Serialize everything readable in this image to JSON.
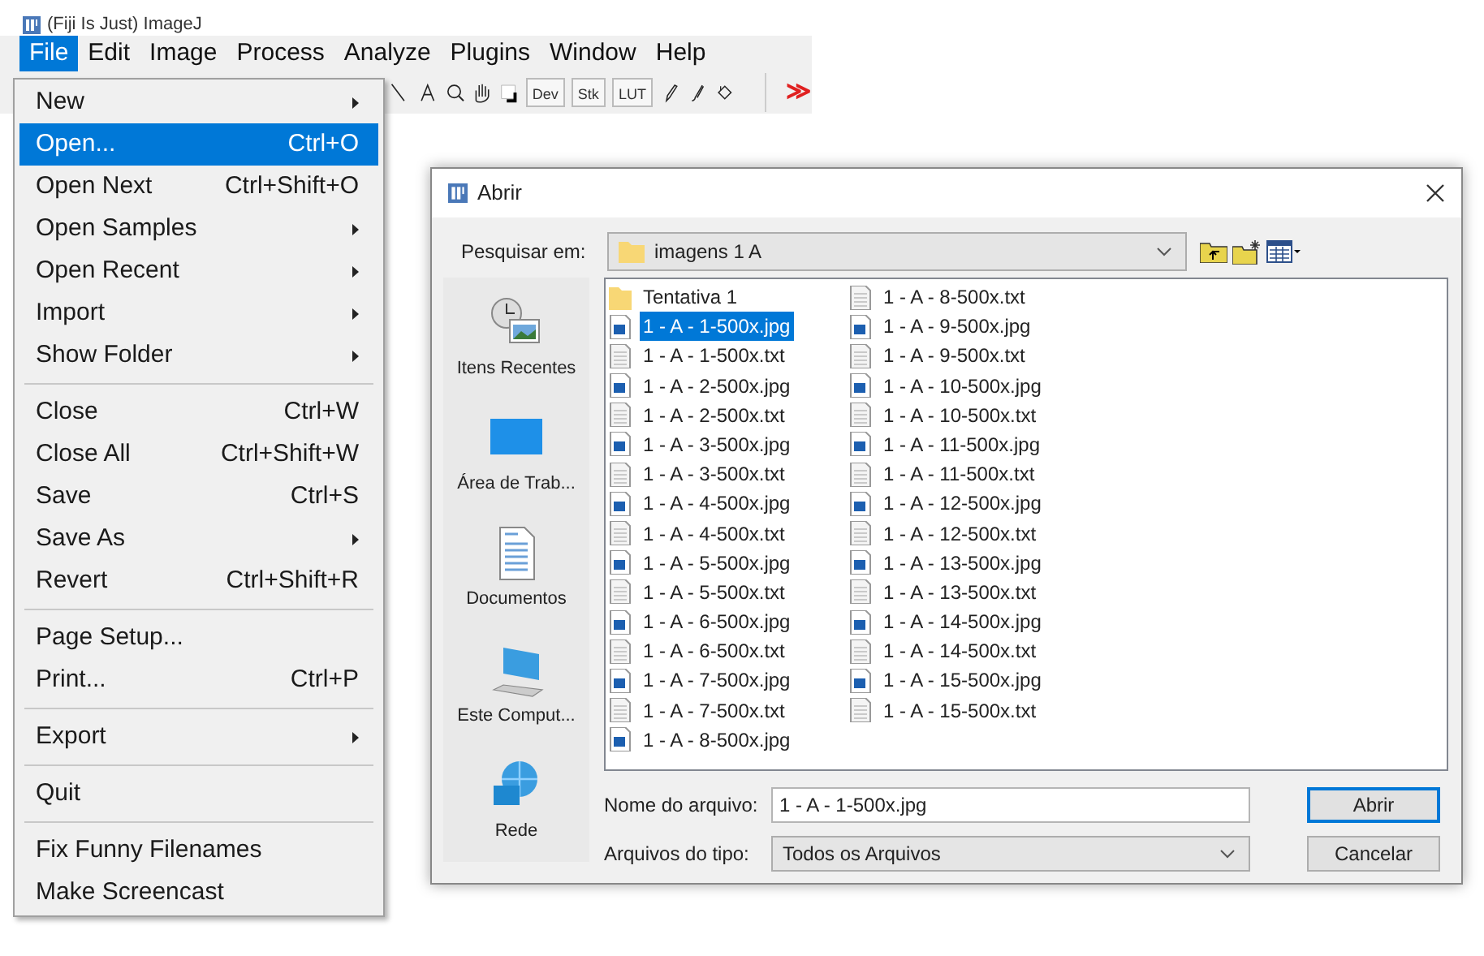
{
  "window": {
    "title": "(Fiji Is Just) ImageJ"
  },
  "menu_bar": [
    {
      "label": "File",
      "selected": true
    },
    {
      "label": "Edit",
      "selected": false
    },
    {
      "label": "Image",
      "selected": false
    },
    {
      "label": "Process",
      "selected": false
    },
    {
      "label": "Analyze",
      "selected": false
    },
    {
      "label": "Plugins",
      "selected": false
    },
    {
      "label": "Window",
      "selected": false
    },
    {
      "label": "Help",
      "selected": false
    }
  ],
  "toolbar": {
    "menus": [
      "Dev",
      "Stk",
      "LUT"
    ],
    "more": "≫"
  },
  "file_menu": [
    {
      "kind": "item",
      "label": "New",
      "submenu": true,
      "selected": false
    },
    {
      "kind": "item",
      "label": "Open...",
      "shortcut": "Ctrl+O",
      "selected": true
    },
    {
      "kind": "item",
      "label": "Open Next",
      "shortcut": "Ctrl+Shift+O",
      "selected": false
    },
    {
      "kind": "item",
      "label": "Open Samples",
      "submenu": true,
      "selected": false
    },
    {
      "kind": "item",
      "label": "Open Recent",
      "submenu": true,
      "selected": false
    },
    {
      "kind": "item",
      "label": "Import",
      "submenu": true,
      "selected": false
    },
    {
      "kind": "item",
      "label": "Show Folder",
      "submenu": true,
      "selected": false
    },
    {
      "kind": "separator"
    },
    {
      "kind": "item",
      "label": "Close",
      "shortcut": "Ctrl+W",
      "selected": false
    },
    {
      "kind": "item",
      "label": "Close All",
      "shortcut": "Ctrl+Shift+W",
      "selected": false
    },
    {
      "kind": "item",
      "label": "Save",
      "shortcut": "Ctrl+S",
      "selected": false
    },
    {
      "kind": "item",
      "label": "Save As",
      "submenu": true,
      "selected": false
    },
    {
      "kind": "item",
      "label": "Revert",
      "shortcut": "Ctrl+Shift+R",
      "selected": false
    },
    {
      "kind": "separator"
    },
    {
      "kind": "item",
      "label": "Page Setup...",
      "selected": false
    },
    {
      "kind": "item",
      "label": "Print...",
      "shortcut": "Ctrl+P",
      "selected": false
    },
    {
      "kind": "separator"
    },
    {
      "kind": "item",
      "label": "Export",
      "submenu": true,
      "selected": false
    },
    {
      "kind": "separator"
    },
    {
      "kind": "item",
      "label": "Quit",
      "selected": false
    },
    {
      "kind": "separator"
    },
    {
      "kind": "item",
      "label": "Fix Funny Filenames",
      "selected": false
    },
    {
      "kind": "item",
      "label": "Make Screencast",
      "selected": false
    }
  ],
  "dialog": {
    "title": "Abrir",
    "look_in_label": "Pesquisar em:",
    "look_in": "imagens 1 A",
    "places": [
      "Itens Recentes",
      "Área de Trab...",
      "Documentos",
      "Este Comput...",
      "Rede"
    ],
    "files": [
      {
        "name": "Tentativa 1",
        "kind": "folder",
        "selected": false
      },
      {
        "name": "1 - A - 1-500x.jpg",
        "kind": "image",
        "selected": true
      },
      {
        "name": "1 - A - 1-500x.txt",
        "kind": "text",
        "selected": false
      },
      {
        "name": "1 - A - 2-500x.jpg",
        "kind": "image",
        "selected": false
      },
      {
        "name": "1 - A - 2-500x.txt",
        "kind": "text",
        "selected": false
      },
      {
        "name": "1 - A - 3-500x.jpg",
        "kind": "image",
        "selected": false
      },
      {
        "name": "1 - A - 3-500x.txt",
        "kind": "text",
        "selected": false
      },
      {
        "name": "1 - A - 4-500x.jpg",
        "kind": "image",
        "selected": false
      },
      {
        "name": "1 - A - 4-500x.txt",
        "kind": "text",
        "selected": false
      },
      {
        "name": "1 - A - 5-500x.jpg",
        "kind": "image",
        "selected": false
      },
      {
        "name": "1 - A - 5-500x.txt",
        "kind": "text",
        "selected": false
      },
      {
        "name": "1 - A - 6-500x.jpg",
        "kind": "image",
        "selected": false
      },
      {
        "name": "1 - A - 6-500x.txt",
        "kind": "text",
        "selected": false
      },
      {
        "name": "1 - A - 7-500x.jpg",
        "kind": "image",
        "selected": false
      },
      {
        "name": "1 - A - 7-500x.txt",
        "kind": "text",
        "selected": false
      },
      {
        "name": "1 - A - 8-500x.jpg",
        "kind": "image",
        "selected": false
      },
      {
        "name": "1 - A - 8-500x.txt",
        "kind": "text",
        "selected": false
      },
      {
        "name": "1 - A - 9-500x.jpg",
        "kind": "image",
        "selected": false
      },
      {
        "name": "1 - A - 9-500x.txt",
        "kind": "text",
        "selected": false
      },
      {
        "name": "1 - A - 10-500x.jpg",
        "kind": "image",
        "selected": false
      },
      {
        "name": "1 - A - 10-500x.txt",
        "kind": "text",
        "selected": false
      },
      {
        "name": "1 - A - 11-500x.jpg",
        "kind": "image",
        "selected": false
      },
      {
        "name": "1 - A - 11-500x.txt",
        "kind": "text",
        "selected": false
      },
      {
        "name": "1 - A - 12-500x.jpg",
        "kind": "image",
        "selected": false
      },
      {
        "name": "1 - A - 12-500x.txt",
        "kind": "text",
        "selected": false
      },
      {
        "name": "1 - A - 13-500x.jpg",
        "kind": "image",
        "selected": false
      },
      {
        "name": "1 - A - 13-500x.txt",
        "kind": "text",
        "selected": false
      },
      {
        "name": "1 - A - 14-500x.jpg",
        "kind": "image",
        "selected": false
      },
      {
        "name": "1 - A - 14-500x.txt",
        "kind": "text",
        "selected": false
      },
      {
        "name": "1 - A - 15-500x.jpg",
        "kind": "image",
        "selected": false
      },
      {
        "name": "1 - A - 15-500x.txt",
        "kind": "text",
        "selected": false
      }
    ],
    "file_name_label": "Nome do arquivo:",
    "file_name": "1 - A - 1-500x.jpg",
    "file_type_label": "Arquivos do tipo:",
    "file_type": "Todos os Arquivos",
    "buttons": [
      {
        "label": "Abrir",
        "default": true
      },
      {
        "label": "Cancelar",
        "default": false
      }
    ]
  }
}
